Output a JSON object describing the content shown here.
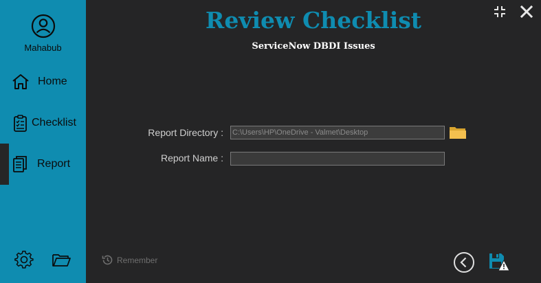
{
  "user": {
    "name": "Mahabub"
  },
  "nav": {
    "home": "Home",
    "checklist": "Checklist",
    "report": "Report"
  },
  "header": {
    "title": "Review Checklist",
    "subtitle": "ServiceNow DBDI Issues"
  },
  "form": {
    "report_directory_label": "Report Directory :",
    "report_directory_value": "C:\\Users\\HP\\OneDrive - Valmet\\Desktop",
    "report_name_label": "Report Name :",
    "report_name_value": ""
  },
  "footer": {
    "remember_label": "Remember"
  },
  "colors": {
    "sidebar": "#0f8cb0",
    "background": "#252526",
    "accent": "#0f8cb0",
    "folder": "#f4c04f"
  },
  "icons": [
    "user-icon",
    "home-icon",
    "checklist-icon",
    "report-icon",
    "settings-icon",
    "folder-icon",
    "minimize-icon",
    "close-icon",
    "history-icon",
    "back-icon",
    "save-warning-icon"
  ]
}
